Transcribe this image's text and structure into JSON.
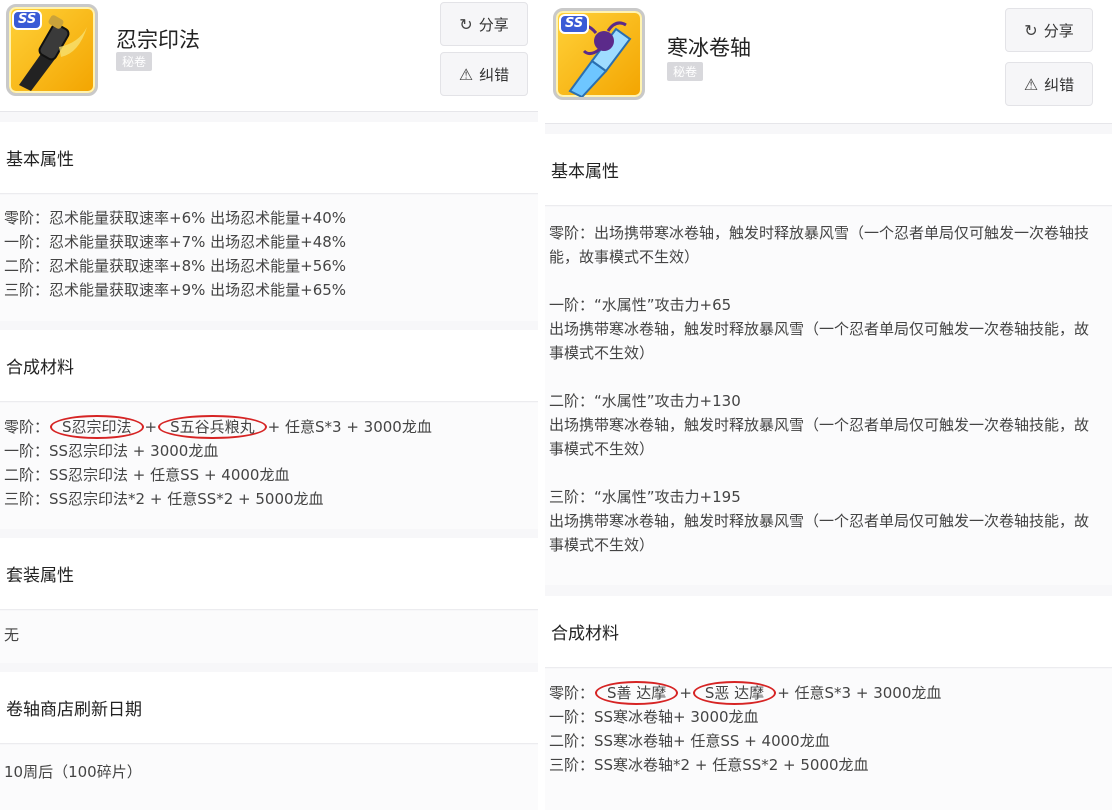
{
  "left": {
    "badge": "SS",
    "item_name": "忍宗印法",
    "item_tag": "秘卷",
    "share_label": "分享",
    "report_label": "纠错",
    "basic": {
      "title": "基本属性",
      "lines": [
        "零阶：忍术能量获取速率+6% 出场忍术能量+40%",
        "一阶：忍术能量获取速率+7% 出场忍术能量+48%",
        "二阶：忍术能量获取速率+8% 出场忍术能量+56%",
        "三阶：忍术能量获取速率+9% 出场忍术能量+65%"
      ]
    },
    "synth": {
      "title": "合成材料",
      "line0_prefix": "零阶：",
      "line0_circle1": "S忍宗印法",
      "line0_sep": "+",
      "line0_circle2": "S五谷兵粮丸",
      "line0_suffix": "+ 任意S*3 + 3000龙血",
      "lines": [
        "一阶：SS忍宗印法 + 3000龙血",
        "二阶：SS忍宗印法 + 任意SS + 4000龙血",
        "三阶：SS忍宗印法*2 + 任意SS*2 + 5000龙血"
      ]
    },
    "set": {
      "title": "套装属性",
      "value": "无"
    },
    "shop": {
      "title": "卷轴商店刷新日期",
      "value": "10周后（100碎片）"
    }
  },
  "right": {
    "badge": "SS",
    "item_name": "寒冰卷轴",
    "item_tag": "秘卷",
    "share_label": "分享",
    "report_label": "纠错",
    "basic": {
      "title": "基本属性",
      "paras": [
        "零阶：出场携带寒冰卷轴，触发时释放暴风雪（一个忍者单局仅可触发一次卷轴技能，故事模式不生效）",
        "一阶：“水属性”攻击力+65\n出场携带寒冰卷轴，触发时释放暴风雪（一个忍者单局仅可触发一次卷轴技能，故事模式不生效）",
        "二阶：“水属性”攻击力+130\n出场携带寒冰卷轴，触发时释放暴风雪（一个忍者单局仅可触发一次卷轴技能，故事模式不生效）",
        "三阶：“水属性”攻击力+195\n出场携带寒冰卷轴，触发时释放暴风雪（一个忍者单局仅可触发一次卷轴技能，故事模式不生效）"
      ]
    },
    "synth": {
      "title": "合成材料",
      "line0_prefix": "零阶：",
      "line0_circle1": "S善 达摩",
      "line0_sep": "+",
      "line0_circle2": "S恶 达摩",
      "line0_suffix": "+ 任意S*3 + 3000龙血",
      "lines": [
        "一阶：SS寒冰卷轴+ 3000龙血",
        "二阶：SS寒冰卷轴+ 任意SS + 4000龙血",
        "三阶：SS寒冰卷轴*2 + 任意SS*2 + 5000龙血"
      ]
    }
  }
}
